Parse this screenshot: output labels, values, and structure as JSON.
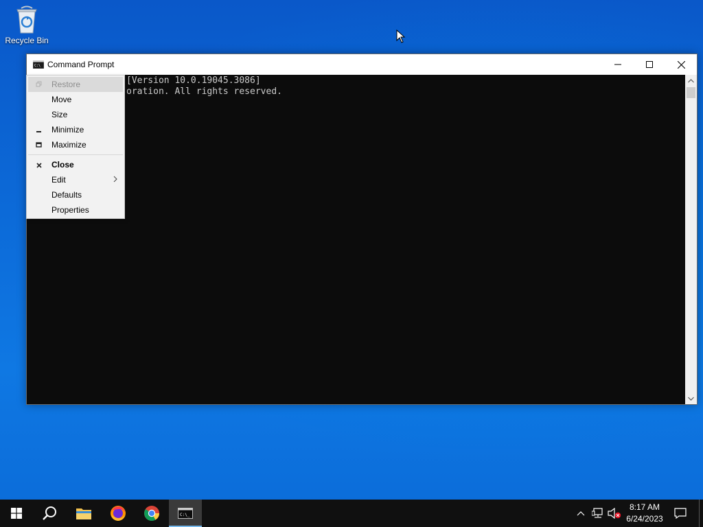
{
  "desktop": {
    "recycle_bin_label": "Recycle Bin"
  },
  "window": {
    "title": "Command Prompt",
    "console_lines": [
      "[Version 10.0.19045.3086]",
      "oration. All rights reserved."
    ]
  },
  "system_menu": {
    "items": [
      {
        "label": "Restore",
        "glyph": "restore-icon",
        "state": "disabled"
      },
      {
        "label": "Move"
      },
      {
        "label": "Size"
      },
      {
        "label": "Minimize",
        "glyph": "minimize-icon"
      },
      {
        "label": "Maximize",
        "glyph": "maximize-icon"
      },
      {
        "label": "Close",
        "glyph": "close-icon",
        "default": true
      },
      {
        "label": "Edit",
        "submenu": true
      },
      {
        "label": "Defaults"
      },
      {
        "label": "Properties"
      }
    ]
  },
  "taskbar": {
    "apps": [
      "start-icon",
      "search-icon",
      "file-explorer-icon",
      "firefox-icon",
      "chrome-icon",
      "command-prompt-icon"
    ],
    "active_app": "command-prompt-icon",
    "clock": {
      "time": "8:17 AM",
      "date": "6/24/2023"
    }
  },
  "colors": {
    "console_bg": "#0c0c0c",
    "console_fg": "#cccccc",
    "taskbar_bg": "#101010",
    "accent": "#76b9ed"
  }
}
